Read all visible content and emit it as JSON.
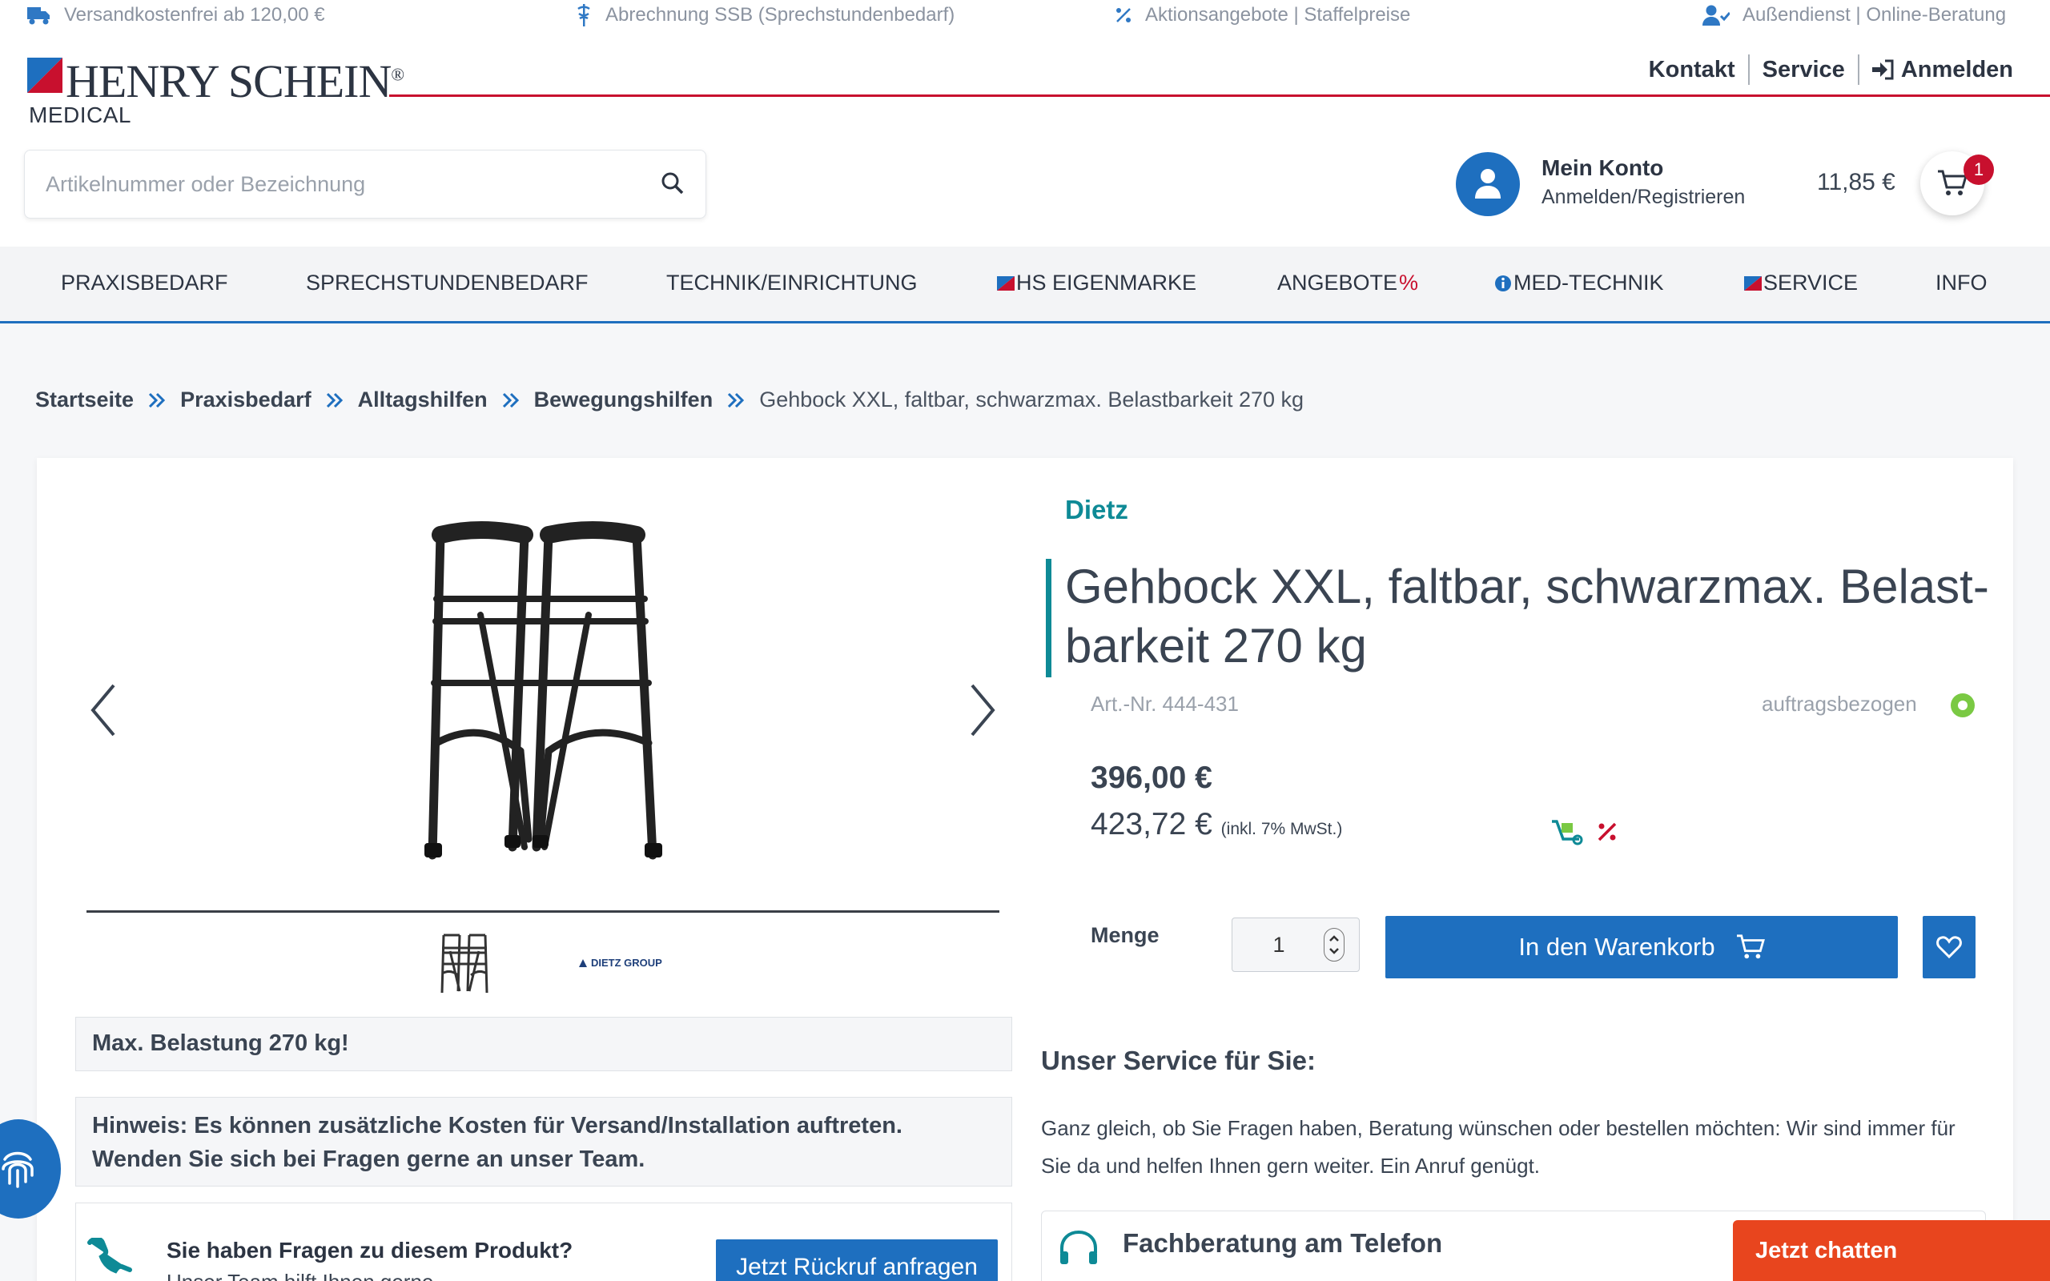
{
  "topbar": {
    "shipping": "Versandkostenfrei ab 120,00 €",
    "billing": "Abrechnung SSB (Sprechstundenbedarf)",
    "offers": "Aktionsangebote | Staffelpreise",
    "field": "Außendienst | Online-Beratung"
  },
  "logo": {
    "name": "HENRY SCHEIN",
    "reg": "®",
    "division": "MEDICAL"
  },
  "header_links": {
    "contact": "Kontakt",
    "service": "Service",
    "login": "Anmelden"
  },
  "search": {
    "placeholder": "Artikelnummer oder Bezeichnung",
    "value": ""
  },
  "account": {
    "title": "Mein Konto",
    "subtitle": "Anmelden/Registrieren"
  },
  "cart": {
    "total": "11,85 €",
    "count": "1"
  },
  "nav": {
    "praxisbedarf": "PRAXISBEDARF",
    "sprechstundenbedarf": "SPRECHSTUNDENBEDARF",
    "technik": "TECHNIK/EINRICHTUNG",
    "hs_eigenmarke": "HS EIGENMARKE",
    "angebote": "ANGEBOTE",
    "angebote_pct": "%",
    "medtechnik": "MED-TECHNIK",
    "service": "SERVICE",
    "info": "INFO"
  },
  "breadcrumb": {
    "home": "Startseite",
    "level1": "Praxisbedarf",
    "level2": "Alltagshilfen",
    "level3": "Bewegungshilfen",
    "current": "Gehbock XXL, faltbar, schwarzmax. Belastbarkeit 270 kg"
  },
  "gallery": {
    "thumb_logo": "DIETZ GROUP"
  },
  "product": {
    "brand": "Dietz",
    "title": "Gehbock XXL, faltbar, schwarzmax. Belast-barkeit 270 kg",
    "art_nr": "Art.-Nr. 444-431",
    "availability": "auftragsbezogen",
    "price_net": "396,00 €",
    "price_gross": "423,72 €",
    "tax_note": "(inkl. 7% MwSt.)",
    "qty_label": "Menge",
    "qty_value": "1",
    "add_to_cart": "In den Warenkorb",
    "accent_color": "#0e8a96",
    "primary_color": "#1e6fbf"
  },
  "notes": {
    "max_load": "Max. Belastung 270 kg!",
    "hint": "Hinweis: Es können zusätzliche Kosten für Versand/Installation auftreten. Wenden Sie sich bei Fragen gerne an unser Team."
  },
  "questions": {
    "title": "Sie haben Fragen zu diesem Produkt?",
    "subtitle": "Unser Team hilft Ihnen gerne.",
    "callback": "Jetzt Rückruf anfragen"
  },
  "service_section": {
    "title": "Unser Service für Sie:",
    "text": "Ganz gleich, ob Sie Fragen haben, Beratung wünschen oder bestellen möchten: Wir sind immer für Sie da und helfen Ihnen gern weiter. Ein Anruf genügt.",
    "phone_title": "Fachberatung am Telefon"
  },
  "chat": {
    "label": "Jetzt chatten"
  }
}
